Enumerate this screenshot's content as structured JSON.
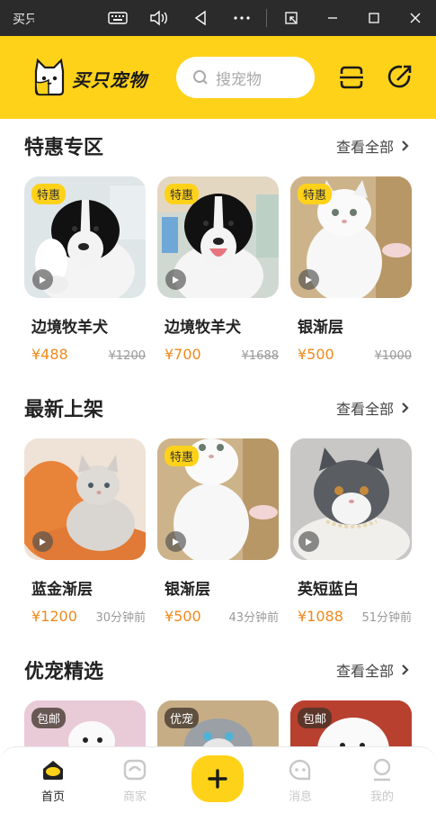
{
  "window": {
    "title": "买只宠物"
  },
  "header": {
    "brand": "买只宠物",
    "search_placeholder": "搜宠物"
  },
  "colors": {
    "accent": "#ffd21a",
    "price": "#f08a1c"
  },
  "sections": [
    {
      "title": "特惠专区",
      "see_all": "查看全部",
      "cards": [
        {
          "badge": "特惠",
          "name": "边境牧羊犬",
          "price": "¥488",
          "sub": "¥1200",
          "image": "border-collie-puppy"
        },
        {
          "badge": "特惠",
          "name": "边境牧羊犬",
          "price": "¥700",
          "sub": "¥1688",
          "image": "border-collie-puppy-smiling"
        },
        {
          "badge": "特惠",
          "name": "银渐层",
          "price": "¥500",
          "sub": "¥1000",
          "image": "white-fluffy-kitten"
        }
      ]
    },
    {
      "title": "最新上架",
      "see_all": "查看全部",
      "cards": [
        {
          "badge": "",
          "name": "蓝金渐层",
          "price": "¥1200",
          "sub": "30分钟前",
          "image": "grey-kitten-on-orange-cushion"
        },
        {
          "badge": "特惠",
          "name": "银渐层",
          "price": "¥500",
          "sub": "43分钟前",
          "image": "white-fluffy-kitten"
        },
        {
          "badge": "",
          "name": "英短蓝白",
          "price": "¥1088",
          "sub": "51分钟前",
          "image": "blue-white-british-shorthair"
        }
      ]
    },
    {
      "title": "优宠精选",
      "see_all": "查看全部",
      "cards": [
        {
          "badge": "包邮",
          "image": "white-poodle-puppy"
        },
        {
          "badge": "优宠",
          "image": "ragdoll-cat"
        },
        {
          "badge": "包邮",
          "image": "samoyed-puppy"
        }
      ]
    }
  ],
  "nav": [
    {
      "label": "首页",
      "icon": "home-icon",
      "active": true
    },
    {
      "label": "商家",
      "icon": "shop-icon",
      "active": false
    },
    {
      "label": "",
      "icon": "plus-icon",
      "active": false
    },
    {
      "label": "消息",
      "icon": "message-icon",
      "active": false
    },
    {
      "label": "我的",
      "icon": "profile-icon",
      "active": false
    }
  ]
}
